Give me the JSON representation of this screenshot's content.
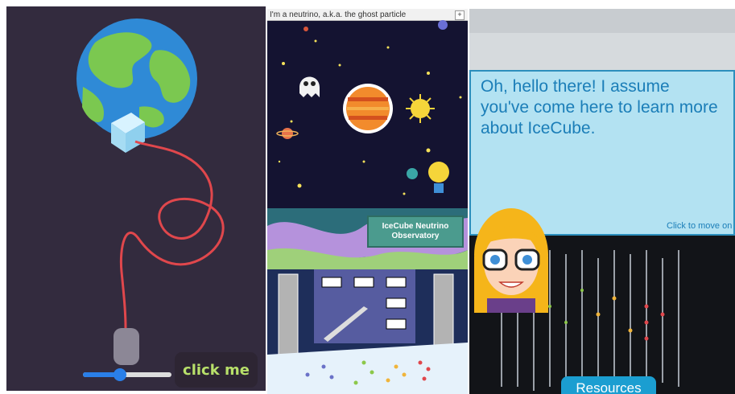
{
  "panel1": {
    "button_label": "click me",
    "slider_value": 0.42,
    "colors": {
      "background": "#332b3e",
      "cord": "#e0474c",
      "accent": "#2a7fe8",
      "button_text": "#b8e06a"
    }
  },
  "panel2": {
    "title": "I'm a neutrino, a.k.a. the ghost particle",
    "expand_label": "+",
    "banner_title": "IceCube Neutrino Observatory"
  },
  "panel3": {
    "speech": "Oh, hello there! I assume you've come here to learn more about IceCube.",
    "advance_hint": "Click to move on",
    "resources_label": "Resources"
  }
}
